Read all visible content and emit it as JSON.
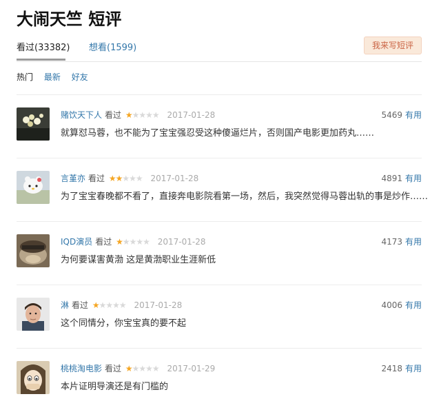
{
  "page": {
    "title": "大闹天竺 短评"
  },
  "tabs": [
    {
      "label": "看过(33382)"
    },
    {
      "label": "想看(1599)"
    }
  ],
  "write_button": {
    "label": "我来写短评"
  },
  "sort": {
    "hot": "热门",
    "latest": "最新",
    "friends": "好友"
  },
  "colors": {
    "link": "#3377aa",
    "star": "#f5a623",
    "accent": "#ca6445"
  },
  "comments": [
    {
      "user": "赌饮天下人",
      "status": "看过",
      "rating": 1,
      "rating_max": 5,
      "date": "2017-01-28",
      "votes": "5469",
      "vote_label": "有用",
      "text": "就算怼马蓉，也不能为了宝宝强忍受这种傻逼烂片，否则国产电影更加药丸……"
    },
    {
      "user": "言堇亦",
      "status": "看过",
      "rating": 2,
      "rating_max": 5,
      "date": "2017-01-28",
      "votes": "4891",
      "vote_label": "有用",
      "text": "为了宝宝春晚都不看了，直接奔电影院看第一场，然后，我突然觉得马蓉出轨的事是炒作……"
    },
    {
      "user": "IQD演员",
      "status": "看过",
      "rating": 1,
      "rating_max": 5,
      "date": "2017-01-28",
      "votes": "4173",
      "vote_label": "有用",
      "text": "为何要谋害黄渤 这是黄渤职业生涯新低"
    },
    {
      "user": "淋",
      "status": "看过",
      "rating": 1,
      "rating_max": 5,
      "date": "2017-01-28",
      "votes": "4006",
      "vote_label": "有用",
      "text": "这个同情分，你宝宝真的要不起"
    },
    {
      "user": "桃桃淘电影",
      "status": "看过",
      "rating": 1,
      "rating_max": 5,
      "date": "2017-01-29",
      "votes": "2418",
      "vote_label": "有用",
      "text": "本片证明导演还是有门槛的"
    }
  ]
}
